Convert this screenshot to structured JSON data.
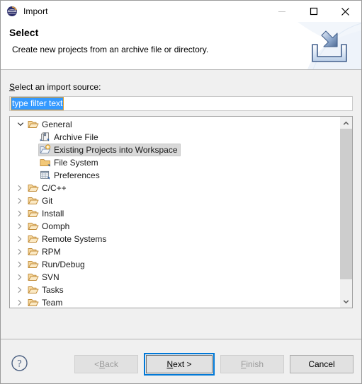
{
  "window": {
    "title": "Import",
    "app_icon": "eclipse-icon",
    "controls": [
      {
        "name": "minimize",
        "glyph": "minimize-icon",
        "disabled": true
      },
      {
        "name": "maximize",
        "glyph": "maximize-icon",
        "disabled": false
      },
      {
        "name": "close",
        "glyph": "close-icon",
        "disabled": false
      }
    ]
  },
  "banner": {
    "title": "Select",
    "description": "Create new projects from an archive file or directory.",
    "icon": "import-arrow-tray-icon"
  },
  "form": {
    "source_label_mnemonic": "S",
    "source_label_rest": "elect an import source:",
    "filter": {
      "value": "type filter text",
      "placeholder": "type filter text",
      "selected": true
    }
  },
  "tree": {
    "items": [
      {
        "label": "General",
        "level": 0,
        "expanded": true,
        "icon": "folder-open-icon",
        "selected": false,
        "has_children": true
      },
      {
        "label": "Archive File",
        "level": 1,
        "expanded": null,
        "icon": "archive-file-icon",
        "selected": false,
        "has_children": false
      },
      {
        "label": "Existing Projects into Workspace",
        "level": 1,
        "expanded": null,
        "icon": "import-project-icon",
        "selected": true,
        "has_children": false
      },
      {
        "label": "File System",
        "level": 1,
        "expanded": null,
        "icon": "folder-filled-icon",
        "selected": false,
        "has_children": false
      },
      {
        "label": "Preferences",
        "level": 1,
        "expanded": null,
        "icon": "preferences-icon",
        "selected": false,
        "has_children": false
      },
      {
        "label": "C/C++",
        "level": 0,
        "expanded": false,
        "icon": "folder-open-icon",
        "selected": false,
        "has_children": true
      },
      {
        "label": "Git",
        "level": 0,
        "expanded": false,
        "icon": "folder-open-icon",
        "selected": false,
        "has_children": true
      },
      {
        "label": "Install",
        "level": 0,
        "expanded": false,
        "icon": "folder-open-icon",
        "selected": false,
        "has_children": true
      },
      {
        "label": "Oomph",
        "level": 0,
        "expanded": false,
        "icon": "folder-open-icon",
        "selected": false,
        "has_children": true
      },
      {
        "label": "Remote Systems",
        "level": 0,
        "expanded": false,
        "icon": "folder-open-icon",
        "selected": false,
        "has_children": true
      },
      {
        "label": "RPM",
        "level": 0,
        "expanded": false,
        "icon": "folder-open-icon",
        "selected": false,
        "has_children": true
      },
      {
        "label": "Run/Debug",
        "level": 0,
        "expanded": false,
        "icon": "folder-open-icon",
        "selected": false,
        "has_children": true
      },
      {
        "label": "SVN",
        "level": 0,
        "expanded": false,
        "icon": "folder-open-icon",
        "selected": false,
        "has_children": true
      },
      {
        "label": "Tasks",
        "level": 0,
        "expanded": false,
        "icon": "folder-open-icon",
        "selected": false,
        "has_children": true
      },
      {
        "label": "Team",
        "level": 0,
        "expanded": false,
        "icon": "folder-open-icon",
        "selected": false,
        "has_children": true
      }
    ],
    "scrollbar": {
      "up_arrow": "chevron-up-icon",
      "down_arrow": "chevron-down-icon"
    }
  },
  "footer": {
    "help_icon": "help-question-icon",
    "buttons": [
      {
        "name": "back",
        "mnemonic": "B",
        "before": "< ",
        "after": "ack",
        "disabled": true,
        "focused": false
      },
      {
        "name": "next",
        "mnemonic": "N",
        "before": "",
        "after": "ext >",
        "disabled": false,
        "focused": true
      },
      {
        "name": "finish",
        "mnemonic": "F",
        "before": "",
        "after": "inish",
        "disabled": true,
        "focused": false
      },
      {
        "name": "cancel",
        "mnemonic": "",
        "before": "Cancel",
        "after": "",
        "disabled": false,
        "focused": false
      }
    ]
  },
  "colors": {
    "accent": "#0078d7",
    "selection_blue": "#3399ff",
    "folder": "#e8b96a",
    "dialog_bg": "#f0f0f0",
    "banner_bg": "#ffffff"
  }
}
